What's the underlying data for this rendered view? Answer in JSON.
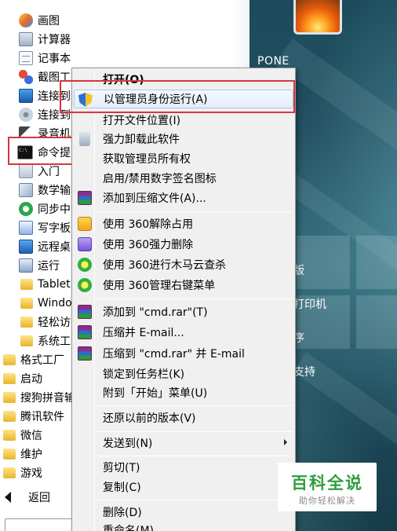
{
  "start_menu": {
    "programs": [
      {
        "label": "画图",
        "icon": "paint-icon"
      },
      {
        "label": "计算器",
        "icon": "calculator-icon"
      },
      {
        "label": "记事本",
        "icon": "notepad-icon"
      },
      {
        "label": "截图工",
        "icon": "snipping-tool-icon"
      },
      {
        "label": "连接到",
        "icon": "projector-icon"
      },
      {
        "label": "连接到",
        "icon": "network-disk-icon"
      },
      {
        "label": "录音机",
        "icon": "microphone-icon"
      },
      {
        "label": "命令提",
        "icon": "cmd-icon"
      },
      {
        "label": "入门",
        "icon": "getting-started-icon"
      },
      {
        "label": "数学输",
        "icon": "math-input-icon"
      },
      {
        "label": "同步中",
        "icon": "sync-center-icon"
      },
      {
        "label": "写字板",
        "icon": "wordpad-icon"
      },
      {
        "label": "远程桌",
        "icon": "remote-desktop-icon"
      },
      {
        "label": "运行",
        "icon": "run-icon"
      },
      {
        "label": "Tablet",
        "icon": "folder-icon"
      },
      {
        "label": "Windo",
        "icon": "folder-icon"
      },
      {
        "label": "轻松访",
        "icon": "folder-icon"
      },
      {
        "label": "系统工",
        "icon": "folder-icon"
      }
    ],
    "folders": [
      {
        "label": "格式工厂",
        "icon": "folder-icon"
      },
      {
        "label": "启动",
        "icon": "folder-icon"
      },
      {
        "label": "搜狗拼音输",
        "icon": "folder-icon"
      },
      {
        "label": "腾讯软件",
        "icon": "folder-icon"
      },
      {
        "label": "微信",
        "icon": "folder-icon"
      },
      {
        "label": "维护",
        "icon": "folder-icon"
      },
      {
        "label": "游戏",
        "icon": "folder-icon"
      }
    ],
    "back_label": "返回",
    "user_name": "PONE",
    "right_items": [
      "版",
      "打印机",
      "序",
      "支持"
    ]
  },
  "context_menu": {
    "items": [
      {
        "label": "打开(O)",
        "bold": true,
        "icon": ""
      },
      {
        "label": "以管理员身份运行(A)",
        "icon": "uac-shield-icon",
        "highlighted": true
      },
      {
        "label": "打开文件位置(I)",
        "icon": ""
      },
      {
        "label": "强力卸载此软件",
        "icon": "recycle-bin-icon"
      },
      {
        "label": "获取管理员所有权",
        "icon": ""
      },
      {
        "label": "启用/禁用数字签名图标",
        "icon": ""
      },
      {
        "label": "添加到压缩文件(A)...",
        "icon": "winrar-icon"
      },
      {
        "label": "使用 360解除占用",
        "icon": "360-unlock-icon"
      },
      {
        "label": "使用 360强力删除",
        "icon": "360-shred-icon"
      },
      {
        "label": "使用 360进行木马云查杀",
        "icon": "360-scan-icon"
      },
      {
        "label": "使用 360管理右键菜单",
        "icon": "360-scan-icon"
      },
      {
        "label": "添加到 \"cmd.rar\"(T)",
        "icon": "winrar-icon"
      },
      {
        "label": "压缩并 E-mail...",
        "icon": "winrar-icon"
      },
      {
        "label": "压缩到 \"cmd.rar\" 并 E-mail",
        "icon": "winrar-icon"
      },
      {
        "label": "锁定到任务栏(K)",
        "icon": ""
      },
      {
        "label": "附到「开始」菜单(U)",
        "icon": ""
      },
      {
        "label": "还原以前的版本(V)",
        "icon": ""
      },
      {
        "label": "发送到(N)",
        "icon": "",
        "submenu": true
      },
      {
        "label": "剪切(T)",
        "icon": ""
      },
      {
        "label": "复制(C)",
        "icon": ""
      },
      {
        "label": "删除(D)",
        "icon": ""
      },
      {
        "label": "重命名(M)",
        "icon": ""
      }
    ]
  },
  "watermark": {
    "title": "百科全说",
    "subtitle": "助你轻松解决"
  },
  "colors": {
    "highlight_frame": "#d8363a",
    "watermark_green": "#2e9e3e"
  }
}
